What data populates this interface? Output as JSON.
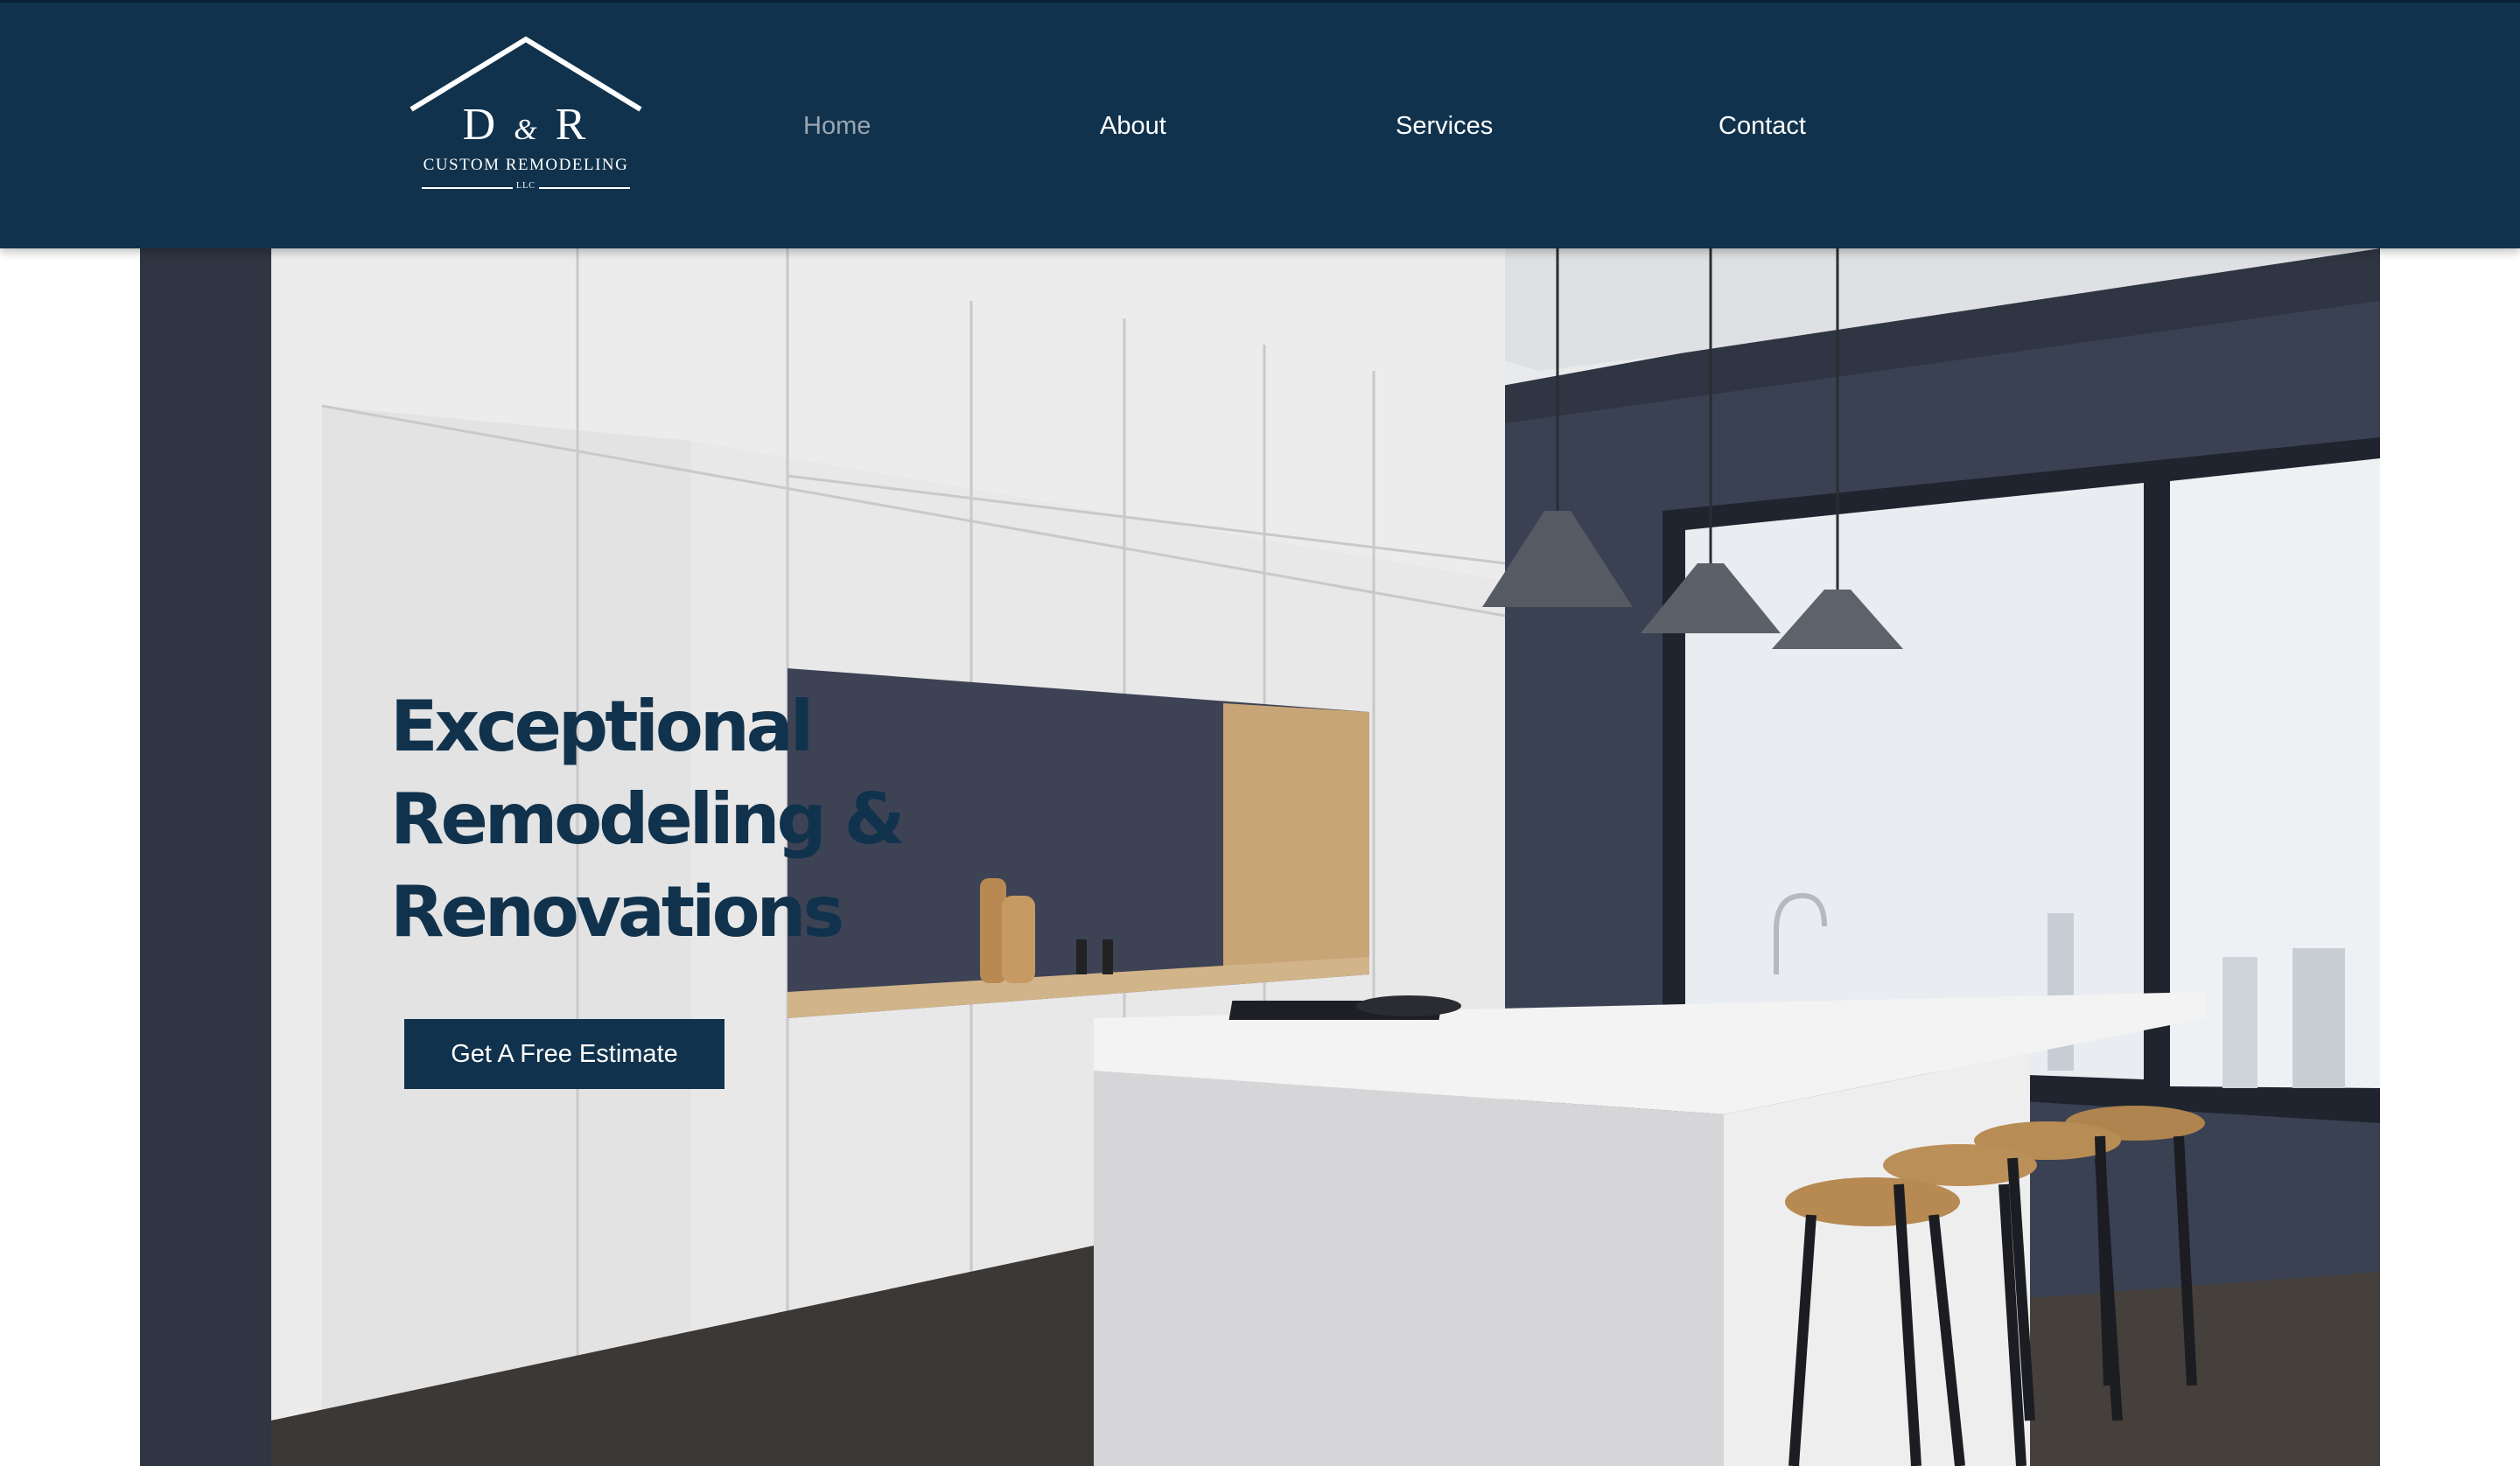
{
  "brand": {
    "mark_left": "D",
    "mark_amp": "&",
    "mark_right": "R",
    "subtitle": "CUSTOM REMODELING",
    "llc": "LLC"
  },
  "nav": {
    "items": [
      {
        "label": "Home",
        "active": true
      },
      {
        "label": "About",
        "active": false
      },
      {
        "label": "Services",
        "active": false
      },
      {
        "label": "Contact",
        "active": false
      }
    ]
  },
  "hero": {
    "title_lines": [
      "Exceptional",
      "Remodeling & ",
      "Renovations"
    ],
    "cta_label": "Get A Free Estimate"
  },
  "colors": {
    "header_bg": "#10324c",
    "accent": "#10324c",
    "nav_active": "#9aa6b2",
    "nav_text": "#ffffff"
  },
  "icons": {
    "logo": "house-roof-logo"
  }
}
